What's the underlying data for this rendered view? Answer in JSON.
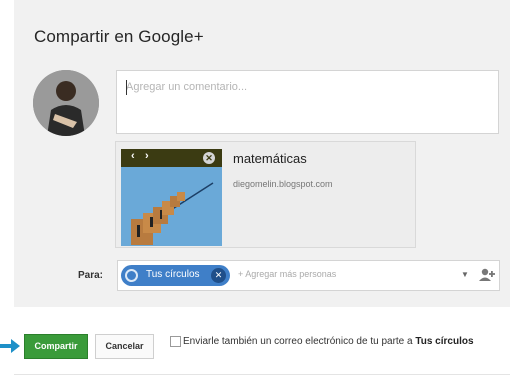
{
  "dialog": {
    "title": "Compartir en Google+",
    "comment_placeholder": "Agregar un comentario...",
    "link_preview": {
      "title": "matemáticas",
      "url": "diegomelin.blogspot.com",
      "prev_arrow": "‹",
      "next_arrow": "›",
      "close_glyph": "✕"
    },
    "recipients": {
      "label": "Para:",
      "chip_label": "Tus círculos",
      "chip_remove": "✕",
      "add_placeholder": "+ Agregar más personas",
      "dropdown_glyph": "▼"
    }
  },
  "actions": {
    "share_label": "Compartir",
    "cancel_label": "Cancelar",
    "email_text_prefix": "Enviarle también un correo electrónico de tu parte a ",
    "email_text_bold": "Tus círculos"
  },
  "colors": {
    "share_green": "#3a9b3a",
    "chip_blue": "#3f7fc8",
    "pointer_arrow": "#1e90c8"
  },
  "icons": {
    "avatar": "user-photo",
    "chip": "circles-icon",
    "person_add": "person-add-icon",
    "pointer": "arrow-right-icon"
  }
}
